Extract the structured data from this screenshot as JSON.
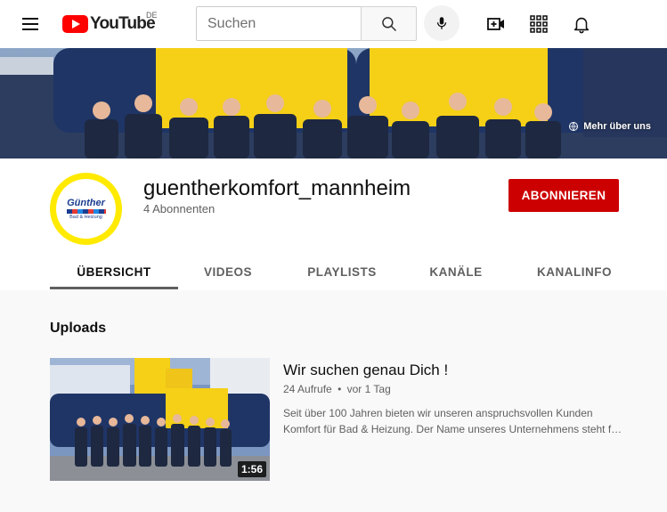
{
  "masthead": {
    "logo_text": "YouTube",
    "country_code": "DE",
    "search_placeholder": "Suchen",
    "icons": [
      "menu-icon",
      "search-icon",
      "mic-icon",
      "create-video-icon",
      "apps-icon",
      "bell-icon"
    ]
  },
  "banner": {
    "about_link_label": "Mehr über uns",
    "about_link_icon": "globe-icon"
  },
  "channel": {
    "avatar_brand": "Günther",
    "avatar_sub": "Bad & Heizung",
    "name": "guentherkomfort_mannheim",
    "subscriber_count": "4 Abonnenten",
    "subscribe_label": "ABONNIEREN",
    "subscribe_color": "#cc0000",
    "avatar_ring_color": "#ffea00"
  },
  "tabs": [
    {
      "label": "ÜBERSICHT",
      "active": true
    },
    {
      "label": "VIDEOS",
      "active": false
    },
    {
      "label": "PLAYLISTS",
      "active": false
    },
    {
      "label": "KANÄLE",
      "active": false
    },
    {
      "label": "KANALINFO",
      "active": false
    }
  ],
  "uploads": {
    "section_title": "Uploads",
    "videos": [
      {
        "title": "Wir suchen genau Dich !",
        "views": "24 Aufrufe",
        "separator": "•",
        "age": "vor 1 Tag",
        "duration": "1:56",
        "description_line1": "Seit über 100 Jahren bieten wir unseren anspruchsvollen Kunden",
        "description_line2": "Komfort für Bad & Heizung. Der Name unseres Unternehmens steht für Fachkompetenz."
      }
    ]
  }
}
